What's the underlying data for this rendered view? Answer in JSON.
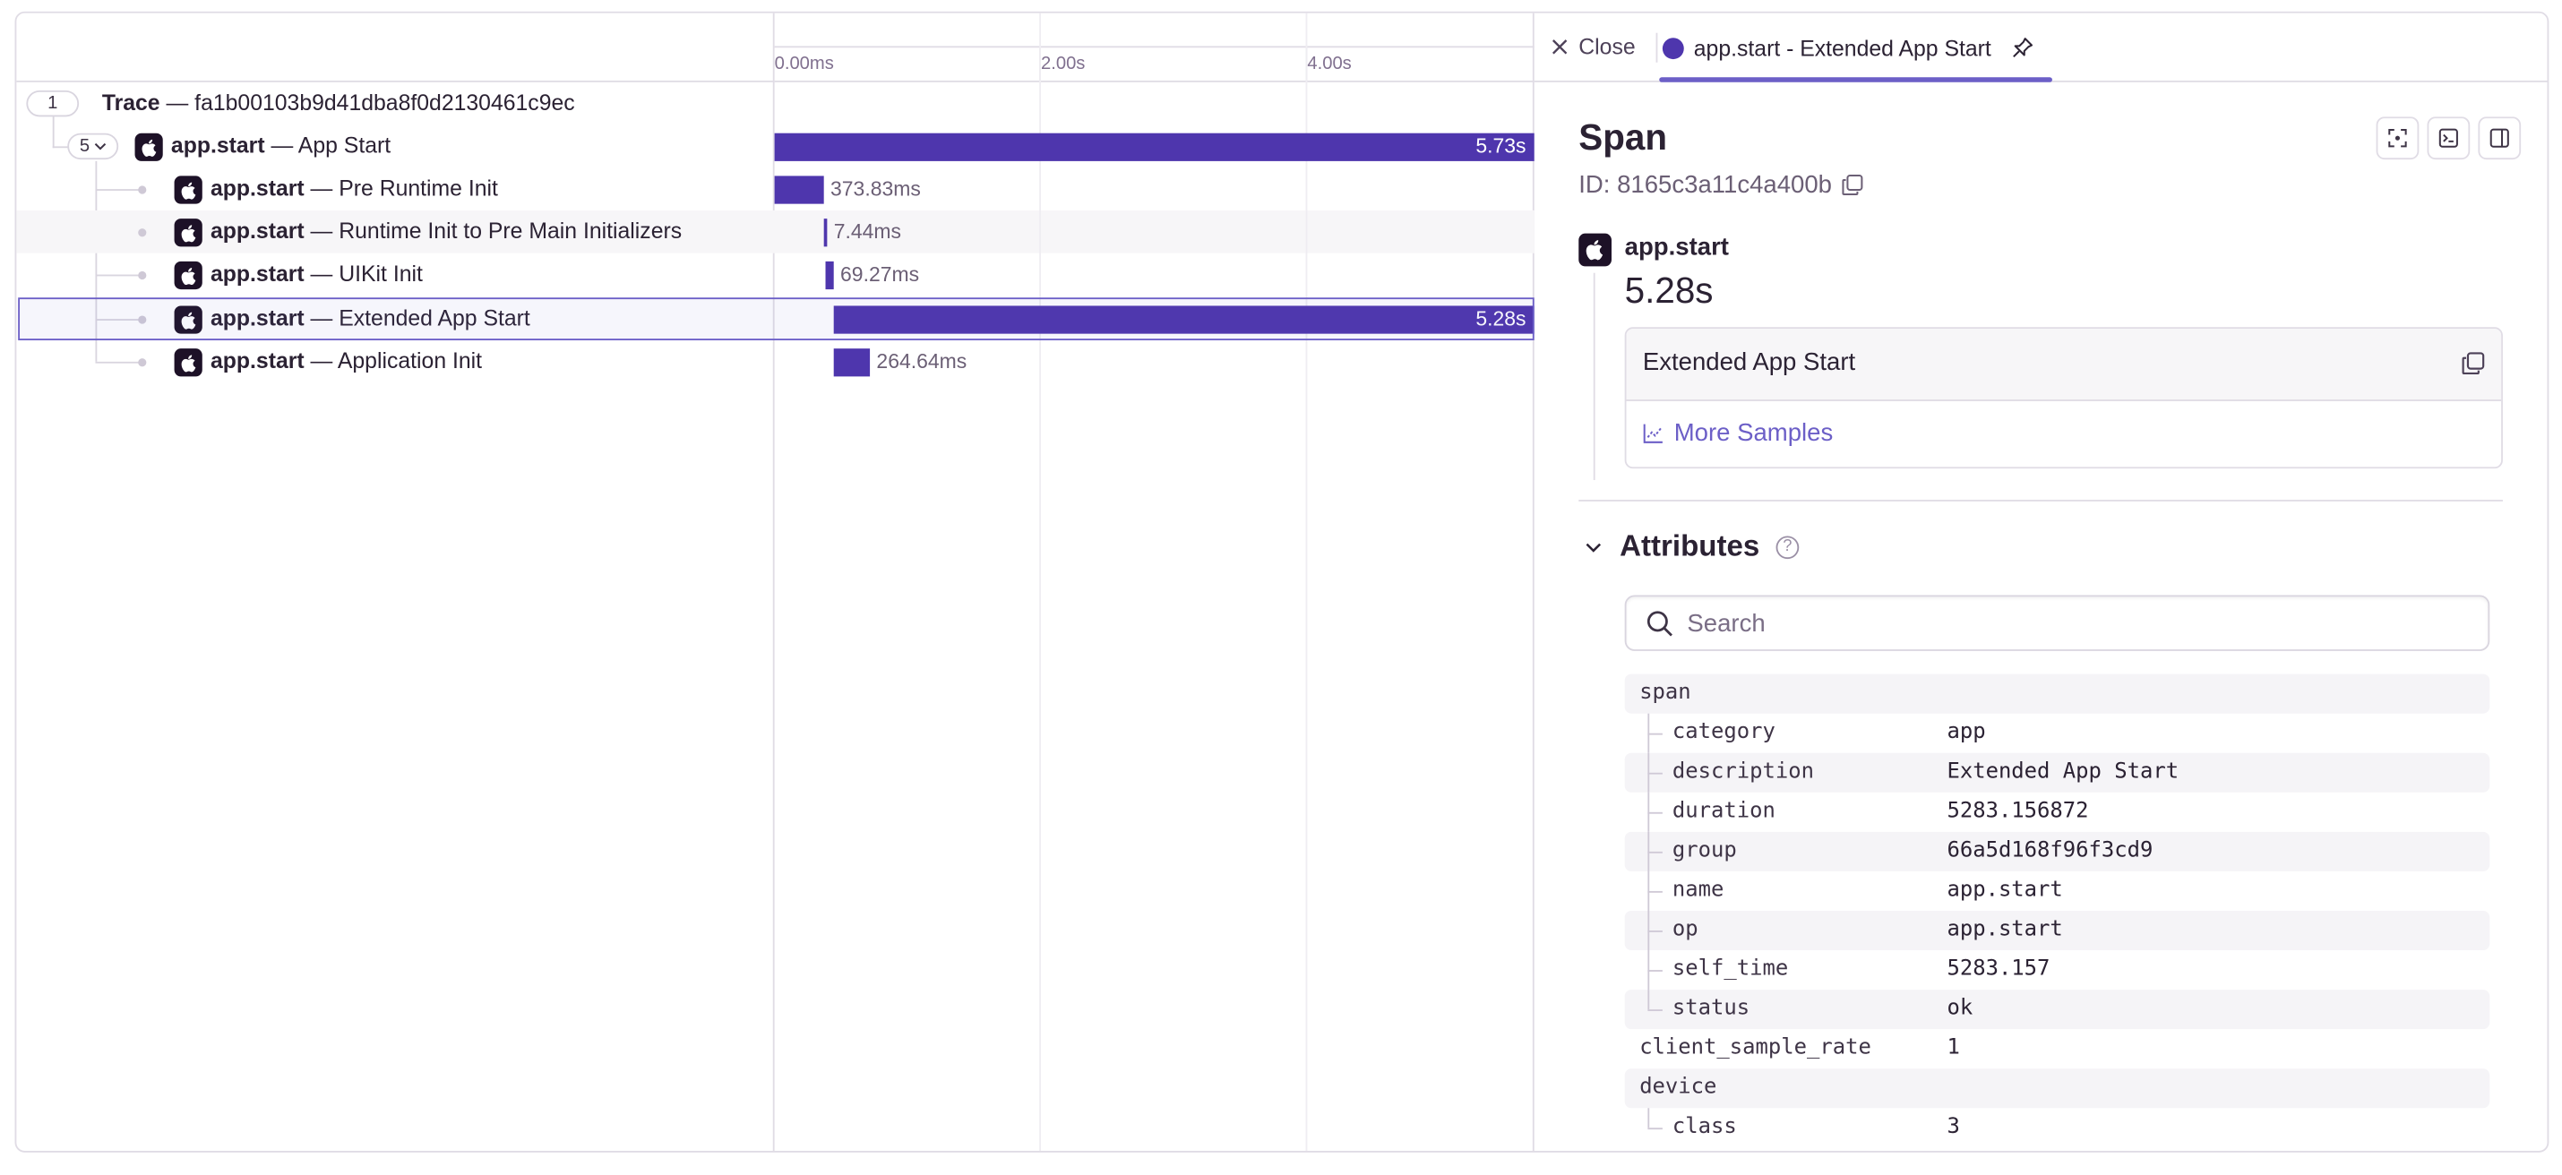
{
  "trace": {
    "header_count": "1",
    "header_label": "Trace",
    "header_sep": "—",
    "trace_id": "fa1b00103b9d41dba8f0d2130461c9ec",
    "root": {
      "count": "5",
      "op": "app.start",
      "sep": "—",
      "name": "App Start",
      "duration": "5.73s",
      "bar_start": 0.0,
      "bar_end": 5.73
    },
    "children": [
      {
        "op": "app.start",
        "sep": "—",
        "name": "Pre Runtime Init",
        "duration": "373.83ms",
        "bar_start": 0.0,
        "bar_end": 0.37383
      },
      {
        "op": "app.start",
        "sep": "—",
        "name": "Runtime Init to Pre Main Initializers",
        "duration": "7.44ms",
        "bar_start": 0.37383,
        "bar_end": 0.38127
      },
      {
        "op": "app.start",
        "sep": "—",
        "name": "UIKit Init",
        "duration": "69.27ms",
        "bar_start": 0.38,
        "bar_end": 0.45
      },
      {
        "op": "app.start",
        "sep": "—",
        "name": "Extended App Start",
        "duration": "5.28s",
        "bar_start": 0.45,
        "bar_end": 5.73,
        "selected": true
      },
      {
        "op": "app.start",
        "sep": "—",
        "name": "Application Init",
        "duration": "264.64ms",
        "bar_start": 0.45,
        "bar_end": 0.71464
      }
    ],
    "timeline": {
      "ticks": [
        "0.00ms",
        "2.00s",
        "4.00s"
      ],
      "tick_values": [
        0,
        2,
        4
      ],
      "max": 5.73
    }
  },
  "details": {
    "close_label": "Close",
    "tab_label": "app.start - Extended App Start",
    "title": "Span",
    "id_label": "ID: 8165c3a11c4a400b",
    "op": "app.start",
    "duration": "5.28s",
    "description": "Extended App Start",
    "more_samples": "More Samples",
    "attributes_title": "Attributes",
    "help": "?",
    "search_placeholder": "Search",
    "attributes": [
      {
        "key": "span",
        "value": "",
        "level": 0
      },
      {
        "key": "category",
        "value": "app",
        "level": 1
      },
      {
        "key": "description",
        "value": "Extended App Start",
        "level": 1
      },
      {
        "key": "duration",
        "value": "5283.156872",
        "level": 1
      },
      {
        "key": "group",
        "value": "66a5d168f96f3cd9",
        "level": 1
      },
      {
        "key": "name",
        "value": "app.start",
        "level": 1
      },
      {
        "key": "op",
        "value": "app.start",
        "level": 1
      },
      {
        "key": "self_time",
        "value": "5283.157",
        "level": 1
      },
      {
        "key": "status",
        "value": "ok",
        "level": 1
      },
      {
        "key": "client_sample_rate",
        "value": "1",
        "level": 0
      },
      {
        "key": "device",
        "value": "",
        "level": 0
      },
      {
        "key": "class",
        "value": "3",
        "level": 1
      }
    ]
  },
  "colors": {
    "accent": "#6c5fc7",
    "bar": "#4e36ad",
    "badge": "#1d1127"
  }
}
